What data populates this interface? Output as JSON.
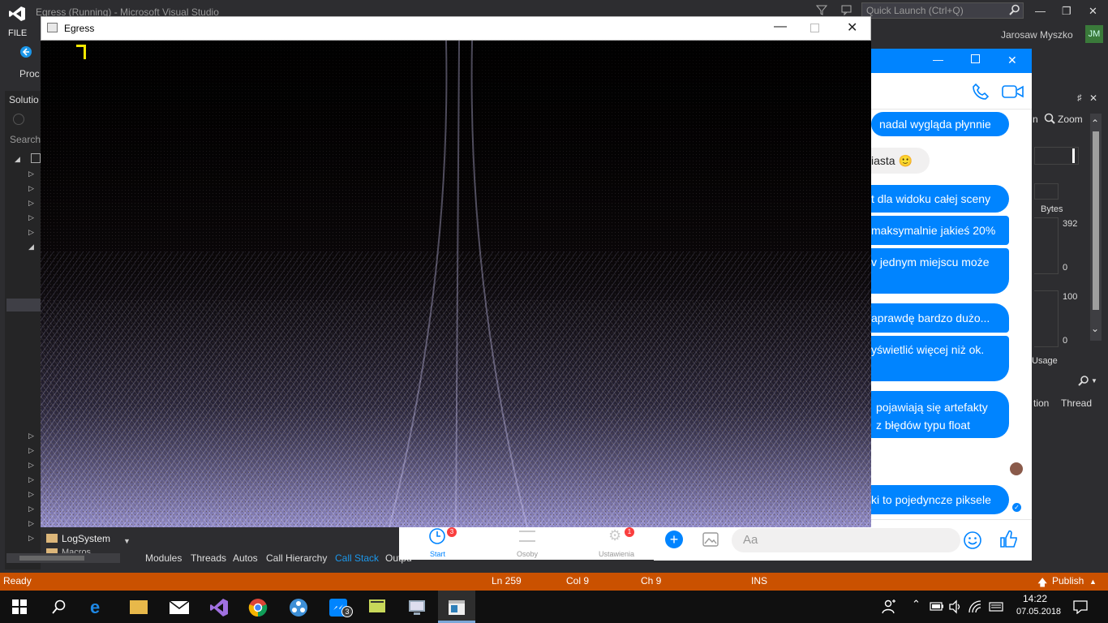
{
  "vs": {
    "window_title": "Egress (Running) - Microsoft Visual Studio",
    "quick_launch_placeholder": "Quick Launch (Ctrl+Q)",
    "user_name": "Jarosaw Myszko",
    "user_initials": "JM",
    "menu_file": "FILE",
    "proc_label": "Proc",
    "solution_title": "Solutio",
    "solution_search": "Search",
    "tree_log_system": "LogSystem",
    "tree_macros": "Macros",
    "bottom_tabs": [
      "Modules",
      "Threads",
      "Autos",
      "Call Hierarchy",
      "Call Stack",
      "Outpu"
    ],
    "status": {
      "state": "Ready",
      "line": "Ln 259",
      "col": "Col 9",
      "ch": "Ch 9",
      "mode": "INS",
      "publish": "Publish"
    },
    "diagnostics": {
      "zoom_label": "Zoom",
      "bytes_label": "Bytes",
      "mem_max": "392",
      "mem_min": "0",
      "cpu_max": "100",
      "cpu_min": "0",
      "usage_label": "Usage",
      "col_tion": "tion",
      "col_thread": "Thread"
    }
  },
  "egress": {
    "title": "Egress"
  },
  "messenger": {
    "messages": [
      "nadal wygląda płynnie",
      "iasta 🙂",
      "t dla widoku całej sceny",
      "maksymalnie jakieś 20%",
      "v jednym miejscu może",
      "aprawdę bardzo dużo...",
      "yświetlić więcej niż ok.",
      "pojawiają się artefakty",
      "z błędów typu float",
      "ki to pojedyncze piksele"
    ],
    "compose_placeholder": "Aa",
    "nav": {
      "start": "Start",
      "people": "Osoby",
      "settings": "Ustawienia",
      "start_badge": "3",
      "settings_badge": "1"
    }
  },
  "taskbar": {
    "time": "14:22",
    "date": "07.05.2018",
    "messenger_badge": "3"
  },
  "colors": {
    "vs_status": "#ca5100",
    "vs_accent": "#1c97ea",
    "messenger_blue": "#0084ff"
  }
}
